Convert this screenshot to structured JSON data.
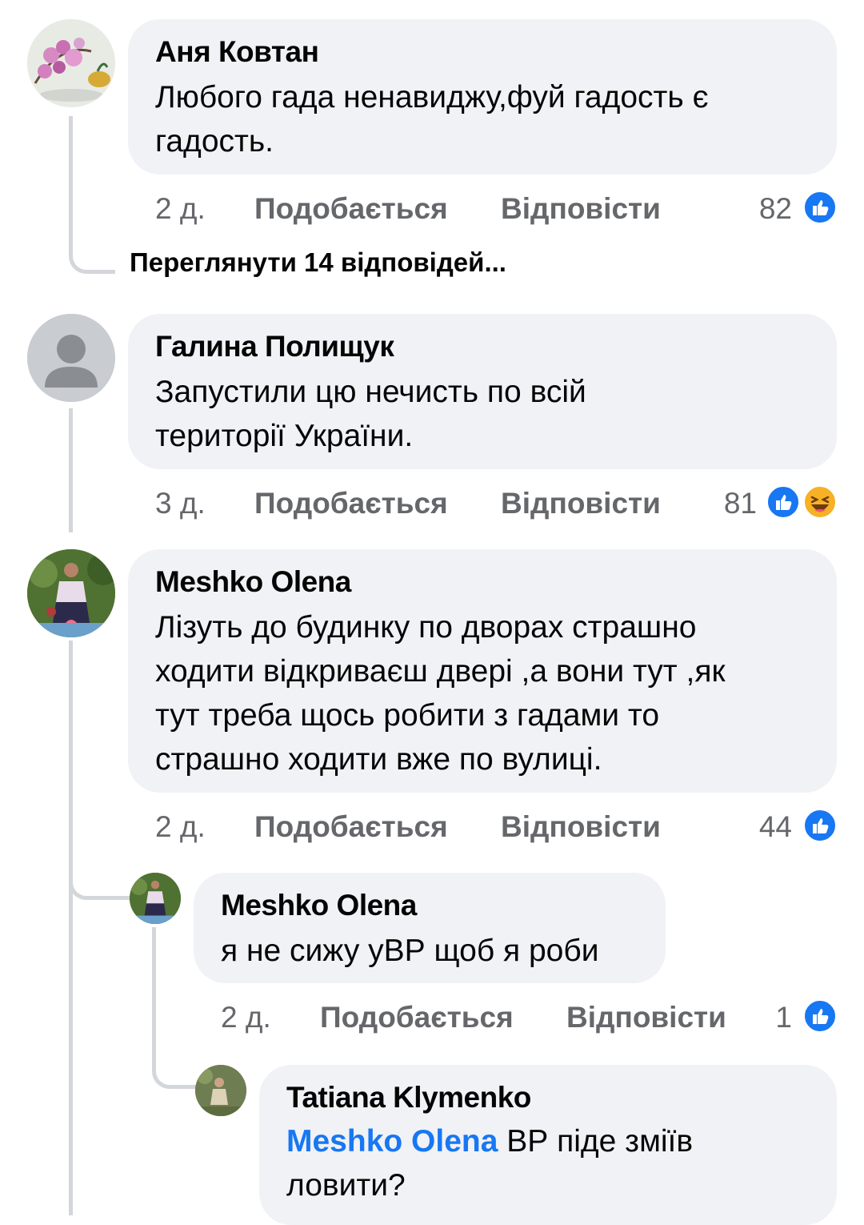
{
  "comments": [
    {
      "author": "Аня Ковтан",
      "text_line1": "Любого гада ненавиджу,фуй гадость є",
      "text_line2": "гадость.",
      "time": "2 д.",
      "like_label": "Подобається",
      "reply_label": "Відповісти",
      "reaction_count": "82",
      "reactions": [
        "like-icon"
      ]
    },
    {
      "author": "Галина Полищук",
      "text_line1": "Запустили цю нечисть  по всій",
      "text_line2": "території України.",
      "time": "3 д.",
      "like_label": "Подобається",
      "reply_label": "Відповісти",
      "reaction_count": "81",
      "reactions": [
        "like-icon",
        "haha-icon"
      ]
    },
    {
      "author": "Meshko Olena",
      "text_line1": "Лізуть до будинку по дворах страшно",
      "text_line2": "ходити відкриваєш двері ,а вони тут ,як",
      "text_line3": "тут треба щось робити з гадами  то",
      "text_line4": "страшно ходити вже по вулиці.",
      "time": "2 д.",
      "like_label": "Подобається",
      "reply_label": "Відповісти",
      "reaction_count": "44",
      "reactions": [
        "like-icon"
      ]
    }
  ],
  "view_replies": "Переглянути 14 відповідей...",
  "replies": [
    {
      "author": "Meshko Olena",
      "text_line1": "я не сижу уВР щоб я роби",
      "time": "2 д.",
      "like_label": "Подобається",
      "reply_label": "Відповісти",
      "reaction_count": "1",
      "reactions": [
        "like-icon"
      ]
    },
    {
      "author": "Tatiana Klymenko",
      "mention": "Meshko Olena",
      "text_line1_rest": " ВР піде зміїв",
      "text_line2": "ловити?"
    }
  ],
  "colors": {
    "bubble": "#f0f2f5",
    "meta": "#65676b",
    "like_blue": "#1877f2",
    "thread_line": "#d3d6db"
  }
}
